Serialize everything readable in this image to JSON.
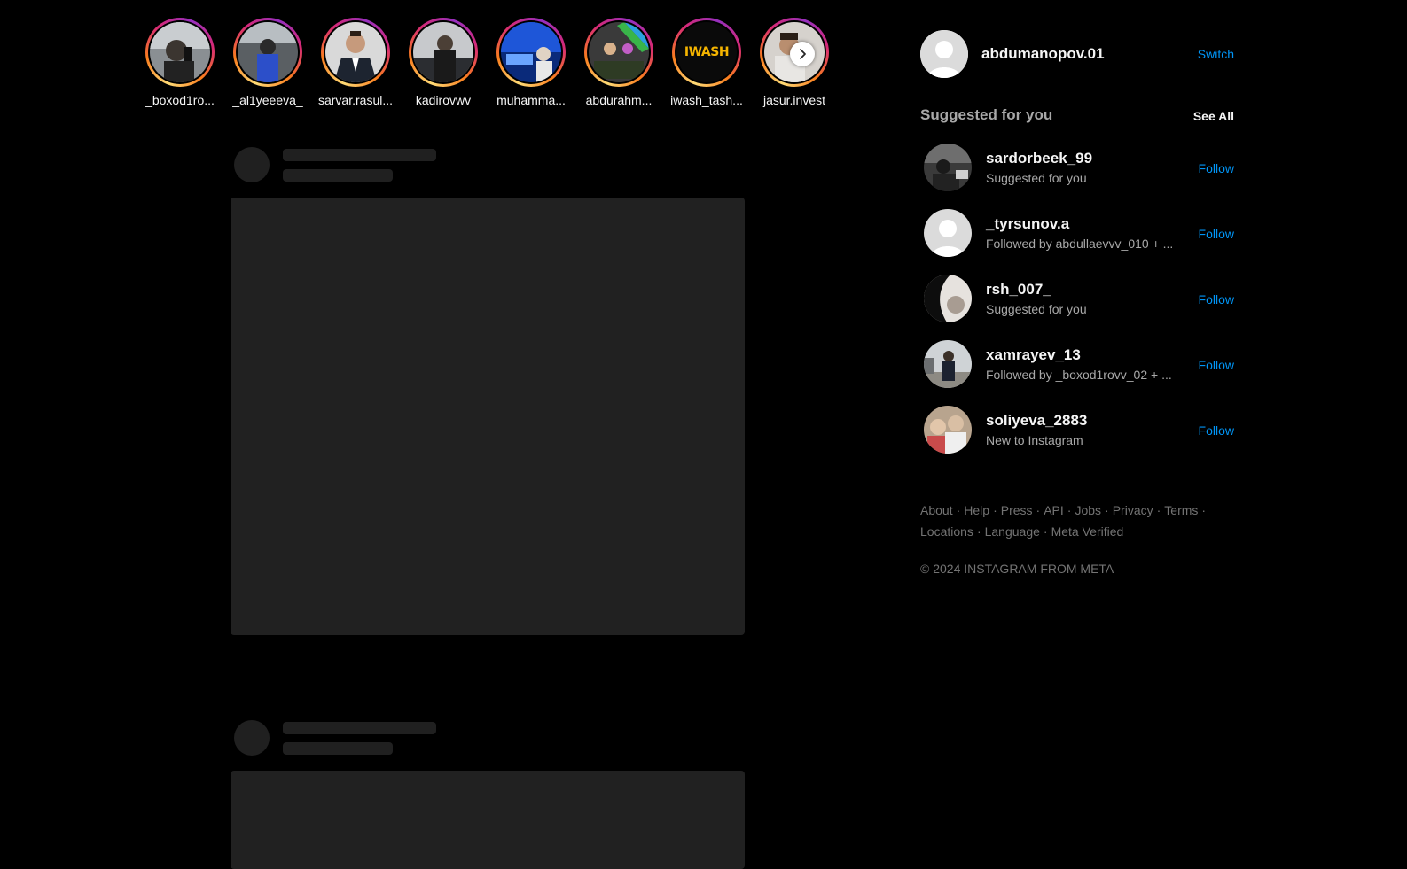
{
  "stories": {
    "items": [
      {
        "username": "_boxod1ro..."
      },
      {
        "username": "_al1yeeeva_"
      },
      {
        "username": "sarvar.rasul..."
      },
      {
        "username": "kadirovwv"
      },
      {
        "username": "muhamma..."
      },
      {
        "username": "abdurahm..."
      },
      {
        "username": "iwash_tash..."
      },
      {
        "username": "jasur.invest"
      }
    ],
    "iwash_logo_text": "IWASH",
    "next_icon": "chevron-right-icon"
  },
  "sidebar": {
    "current_user": "abdumanopov.01",
    "switch_label": "Switch",
    "suggested_title": "Suggested for you",
    "see_all_label": "See All",
    "suggestions": [
      {
        "username": "sardorbeek_99",
        "subtitle": "Suggested for you",
        "action": "Follow"
      },
      {
        "username": "_tyrsunov.a",
        "subtitle": "Followed by abdullaevvv_010 + ...",
        "action": "Follow"
      },
      {
        "username": "rsh_007_",
        "subtitle": "Suggested for you",
        "action": "Follow"
      },
      {
        "username": "xamrayev_13",
        "subtitle": "Followed by _boxod1rovv_02 + ...",
        "action": "Follow"
      },
      {
        "username": "soliyeva_2883",
        "subtitle": "New to Instagram",
        "action": "Follow"
      }
    ]
  },
  "footer": {
    "links": [
      "About",
      "Help",
      "Press",
      "API",
      "Jobs",
      "Privacy",
      "Terms",
      "Locations",
      "Language",
      "Meta Verified"
    ],
    "copyright": "© 2024 INSTAGRAM FROM META"
  },
  "colors": {
    "background": "#000000",
    "link_blue": "#0095f6",
    "muted_text": "#a8a8a8",
    "skeleton": "#202020"
  }
}
